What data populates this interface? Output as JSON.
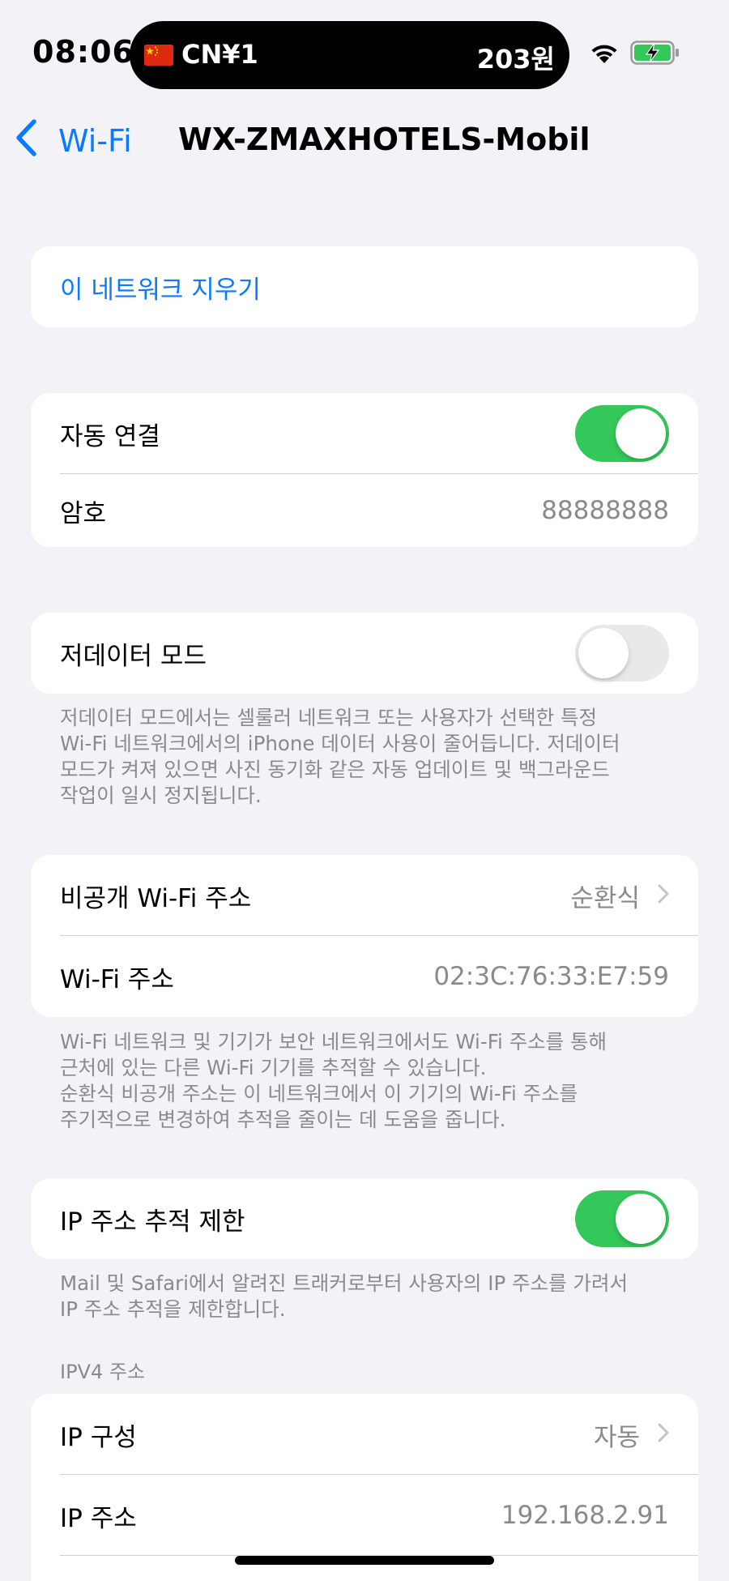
{
  "status_bar": {
    "time": "08:06",
    "island_left": "CN¥1",
    "island_right": "203원",
    "flag_icon": "china-flag-icon",
    "wifi_icon": "wifi-icon",
    "battery_icon": "battery-charging-icon"
  },
  "nav": {
    "back_label": "Wi-Fi",
    "title": "WX-ZMAXHOTELS-Mobil"
  },
  "forget": {
    "label": "이 네트워크 지우기"
  },
  "auto_join": {
    "label": "자동 연결",
    "toggle_on": true
  },
  "password": {
    "label": "암호",
    "value": "88888888"
  },
  "low_data": {
    "label": "저데이터 모드",
    "toggle_on": false,
    "footnote_lines": [
      "저데이터 모드에서는 셀룰러 네트워크 또는 사용자가 선택한 특정",
      "Wi-Fi 네트워크에서의 iPhone 데이터 사용이 줄어듭니다. 저데이터",
      "모드가 켜져 있으면 사진 동기화 같은 자동 업데이트 및 백그라운드",
      "작업이 일시 정지됩니다."
    ]
  },
  "private_address": {
    "label": "비공개 Wi-Fi 주소",
    "value": "순환식"
  },
  "wifi_address": {
    "label": "Wi-Fi 주소",
    "value": "02:3C:76:33:E7:59",
    "footnote_lines": [
      "Wi-Fi 네트워크 및 기기가 보안 네트워크에서도 Wi-Fi 주소를 통해",
      "근처에 있는 다른 Wi-Fi 기기를 추적할 수 있습니다.",
      "순환식 비공개 주소는 이 네트워크에서 이 기기의 Wi-Fi 주소를",
      "주기적으로 변경하여 추적을 줄이는 데 도움을 줍니다."
    ]
  },
  "limit_ip_tracking": {
    "label": "IP 주소 추적 제한",
    "toggle_on": true,
    "footnote_lines": [
      "Mail 및 Safari에서 알려진 트래커로부터 사용자의 IP 주소를 가려서",
      "IP 주소 추적을 제한합니다."
    ]
  },
  "ipv4": {
    "header": "IPV4 주소",
    "config_label": "IP 구성",
    "config_value": "자동",
    "address_label": "IP 주소",
    "address_value": "192.168.2.91"
  },
  "colors": {
    "accent": "#0a7aff",
    "toggle_on": "#34c759",
    "toggle_off": "#e9e9ea",
    "background": "#f2f2f7",
    "secondary_text": "#8a8a8e"
  }
}
